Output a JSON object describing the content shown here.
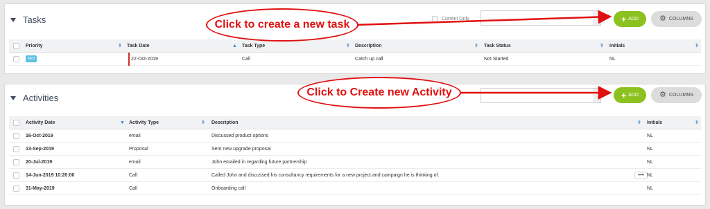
{
  "tasks": {
    "title": "Tasks",
    "current_only_label": "Current Only",
    "add_label": "ADD",
    "columns_label": "COLUMNS",
    "columns": [
      "Priority",
      "Task Date",
      "Task Type",
      "Description",
      "Task Status",
      "Initials"
    ],
    "rows": [
      {
        "priority": "Med",
        "task_date": "22-Oct-2019",
        "task_type": "Call",
        "description": "Catch up call",
        "status": "Not Started",
        "initials": "NL"
      }
    ]
  },
  "activities": {
    "title": "Activities",
    "add_label": "ADD",
    "columns_label": "COLUMNS",
    "columns": [
      "Activity Date",
      "Activity Type",
      "Description",
      "Initials"
    ],
    "more_label": "•••",
    "rows": [
      {
        "date": "16-Oct-2019",
        "type": "email",
        "description": "Discussed product options",
        "initials": "NL"
      },
      {
        "date": "13-Sep-2019",
        "type": "Proposal",
        "description": "Sent new upgrade proposal",
        "initials": "NL"
      },
      {
        "date": "20-Jul-2019",
        "type": "email",
        "description": "John emailed in regarding future partnership",
        "initials": "NL"
      },
      {
        "date": "14-Jun-2019 10:20:00",
        "type": "Call",
        "description": "Called John and discussed his consultancy requirements for a new project and campaign he is thinking of.",
        "initials": "NL"
      },
      {
        "date": "31-May-2019",
        "type": "Call",
        "description": "Onboarding call",
        "initials": "NL"
      }
    ]
  },
  "annotations": {
    "task_callout": "Click to create a new task",
    "activity_callout": "Click to Create new Activity",
    "color": "#e01010"
  },
  "colors": {
    "add_button": "#8cc21f",
    "columns_button": "#dcdcdc",
    "priority_badge": "#5bc0de",
    "sort_arrow": "#3a86d0"
  }
}
